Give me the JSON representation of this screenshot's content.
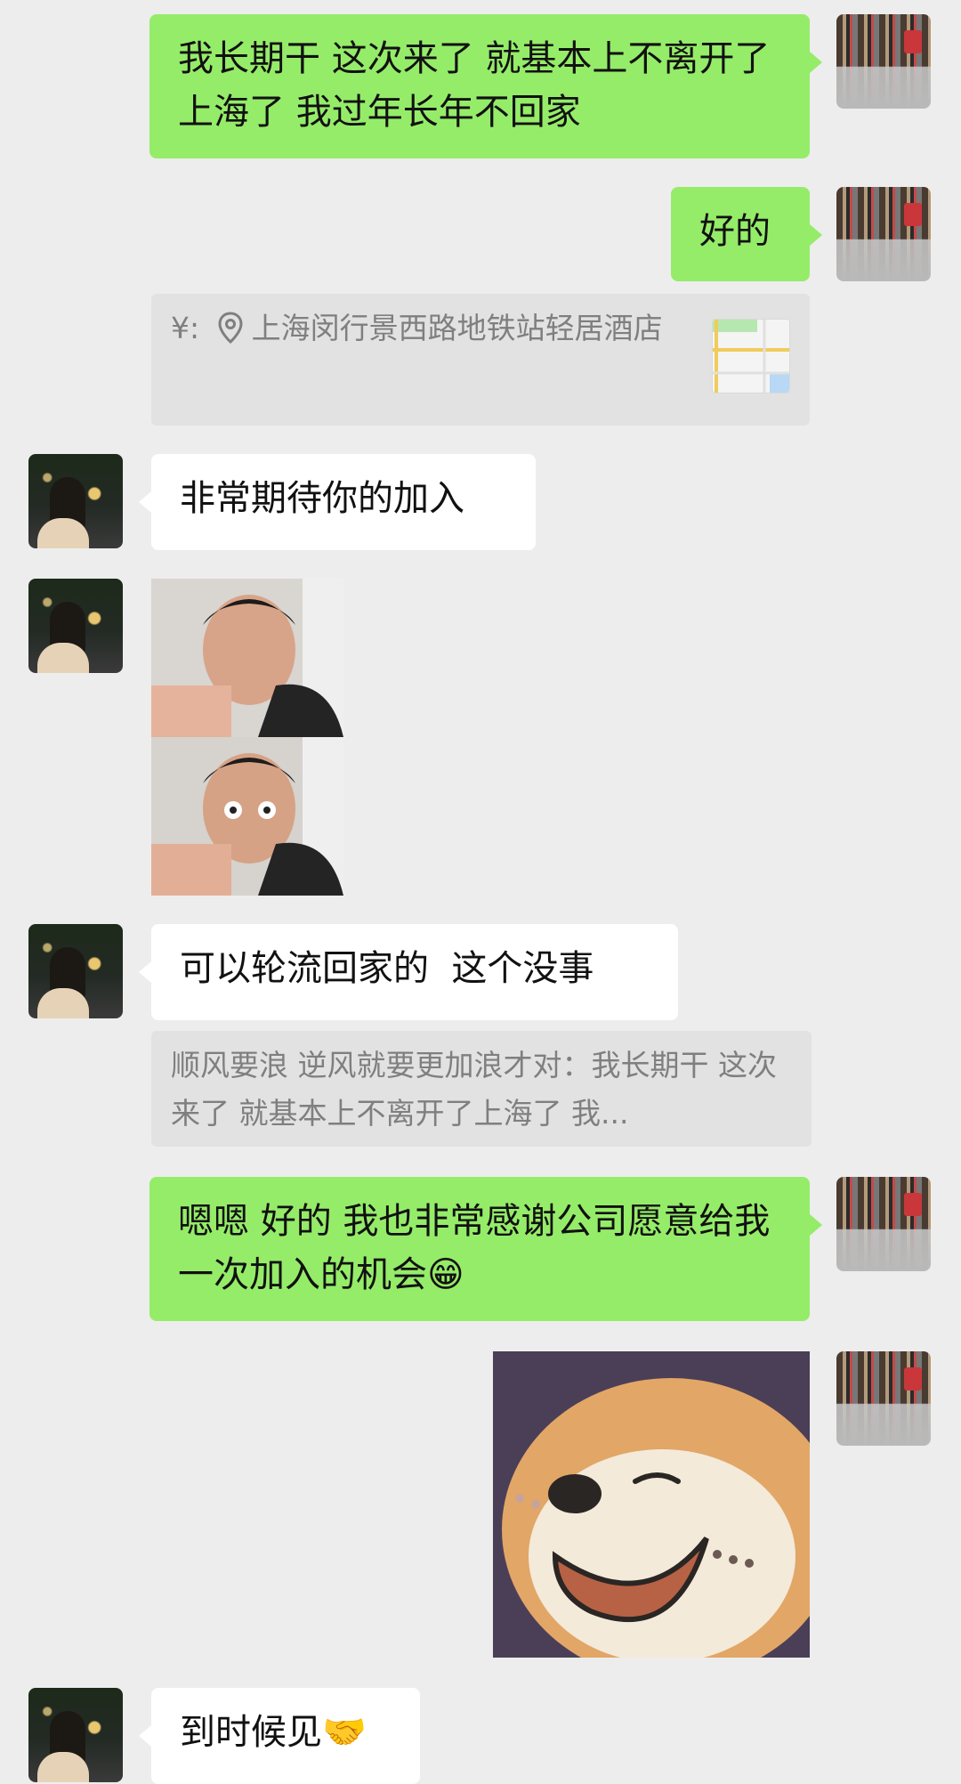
{
  "messages": [
    {
      "side": "right",
      "type": "text",
      "text": "我长期干 这次来了 就基本上不离开了上海了 我过年长年不回家"
    },
    {
      "side": "right",
      "type": "text",
      "text": "好的"
    },
    {
      "side": "right",
      "type": "quote",
      "prefix": "¥:",
      "text": "上海闵行景西路地铁站轻居酒店"
    },
    {
      "side": "left",
      "type": "text",
      "text": "非常期待你的加入"
    },
    {
      "side": "left",
      "type": "image"
    },
    {
      "side": "left",
      "type": "text",
      "text": "可以轮流回家的  这个没事"
    },
    {
      "side": "left",
      "type": "quote",
      "text": "顺风要浪 逆风就要更加浪才对：我长期干 这次来了 就基本上不离开了上海了 我..."
    },
    {
      "side": "right",
      "type": "text",
      "text": "嗯嗯 好的 我也非常感谢公司愿意给我一次加入的机会😁"
    },
    {
      "side": "right",
      "type": "image"
    },
    {
      "side": "left",
      "type": "text",
      "text": "到时候见🤝"
    }
  ],
  "icons": {
    "location": "location-pin-icon",
    "map": "map-thumbnail-icon"
  },
  "colors": {
    "background": "#ededed",
    "sent_bubble": "#95ec69",
    "received_bubble": "#ffffff",
    "quote_bg": "#e2e2e2",
    "quote_text": "#7f7f7f"
  }
}
